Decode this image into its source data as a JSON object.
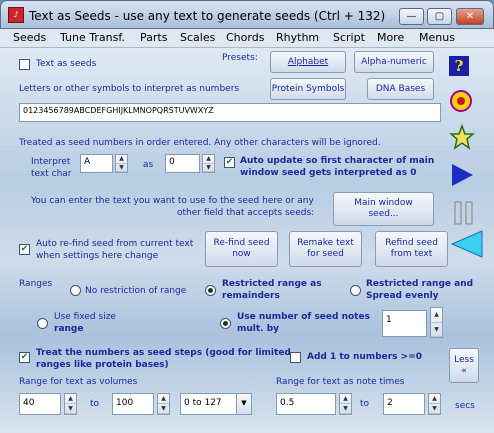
{
  "window": {
    "title": "Text as Seeds - use any text to generate seeds (Ctrl + 132)",
    "app_icon": "music-icon",
    "minimize": "—",
    "maximize": "▢",
    "close": "✕"
  },
  "menu": [
    "Seeds",
    "Tune Transf.",
    "Parts",
    "Scales",
    "Chords",
    "Rhythm",
    "Script",
    "More",
    "Menus"
  ],
  "presets": {
    "label": "Presets:",
    "alphabet": "Alphabet",
    "alpha_numeric": "Alpha-numeric",
    "protein": "Protein Symbols",
    "dna": "DNA Bases"
  },
  "text_as_seeds": {
    "label": "Text as seeds",
    "checked": false
  },
  "letters_label": "Letters or other symbols to interpret as numbers",
  "symbols_value": "0123456789ABCDEFGHIJKLMNOPQRSTUVWXYZ",
  "treated_note": "Treated as seed numbers in order entered. Any other characters will be ignored.",
  "interpret": {
    "label1": "Interpret",
    "label2": "text char",
    "char_value": "A",
    "as_label": "as",
    "num_value": "0"
  },
  "auto_update": {
    "label1": "Auto update so first character of main",
    "label2": "window seed gets interpreted as 0",
    "checked": true
  },
  "enter_text": {
    "line1": "You can enter the text you want to use fo the seed here or any",
    "line2": "other field that accepts seeds:"
  },
  "main_window_seed": {
    "line1": "Main window",
    "line2": "seed..."
  },
  "auto_refind": {
    "line1": "Auto re-find seed from current text",
    "line2": "when settings here change",
    "checked": true
  },
  "refind_now": {
    "line1": "Re-find seed",
    "line2": "now"
  },
  "remake_text": {
    "line1": "Remake text",
    "line2": "for seed"
  },
  "refind_from_text": {
    "line1": "Refind seed",
    "line2": "from text"
  },
  "ranges": {
    "label": "Ranges",
    "no_restriction": "No restriction of range",
    "restricted_remainders_1": "Restricted range as",
    "restricted_remainders_2": "remainders",
    "restricted_spread_1": "Restricted range and",
    "restricted_spread_2": "Spread evenly",
    "fixed_size_1": "Use fixed size",
    "fixed_size_2": "range",
    "use_number_1": "Use number of seed notes",
    "use_number_2": "mult. by",
    "mult_value": "1",
    "selected": "restricted_remainders_and_use_number"
  },
  "treat_numbers": {
    "line1": "Treat the numbers as seed steps (good for limited",
    "line2": "ranges like protein bases)",
    "checked": true
  },
  "add_one": {
    "label": "Add 1 to numbers >=0",
    "checked": false
  },
  "less_button": {
    "line1": "Less",
    "line2": "«"
  },
  "volumes": {
    "label": "Range for text as volumes",
    "from": "40",
    "to_label": "to",
    "to": "100",
    "preset": "0 to 127"
  },
  "times": {
    "label": "Range for text as note times",
    "from": "0.5",
    "to_label": "to",
    "to": "2",
    "unit": "secs"
  },
  "side_icons": [
    "help-icon",
    "target-icon",
    "star-icon",
    "play-icon",
    "pause-icon",
    "rewind-icon"
  ],
  "colors": {
    "label_blue": "#1a2a9a",
    "title_bg": "#c8d7ea"
  }
}
